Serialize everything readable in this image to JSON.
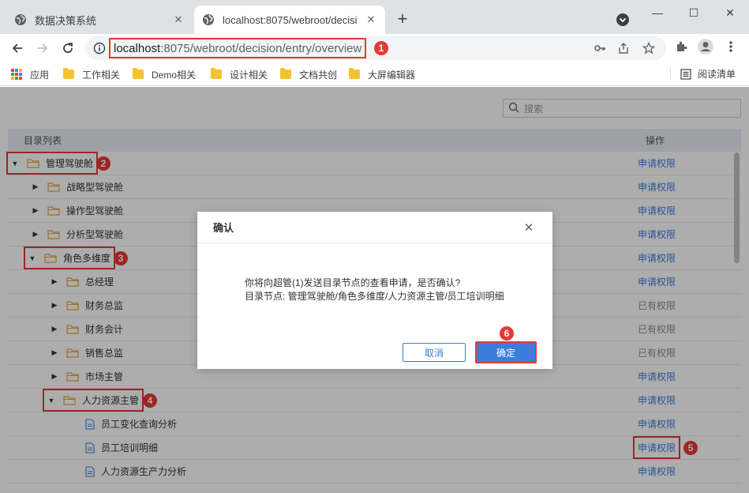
{
  "browser": {
    "tabs": [
      {
        "title": "数据决策系统",
        "active": false
      },
      {
        "title": "localhost:8075/webroot/decisi",
        "active": true
      }
    ],
    "url_host": "localhost",
    "url_rest": ":8075/webroot/decision/entry/overview",
    "bookmarks": [
      "应用",
      "工作相关",
      "Demo相关",
      "设计相关",
      "文档共创",
      "大屏编辑器"
    ],
    "reading_list": "阅读清单",
    "folder_color": "#f4c430"
  },
  "page": {
    "search_placeholder": "搜索",
    "table_header": {
      "name": "目录列表",
      "op": "操作"
    },
    "rows": [
      {
        "label": "管理驾驶舱",
        "op": "申请权限"
      },
      {
        "label": "战略型驾驶舱",
        "op": "申请权限"
      },
      {
        "label": "操作型驾驶舱",
        "op": "申请权限"
      },
      {
        "label": "分析型驾驶舱",
        "op": "申请权限"
      },
      {
        "label": "角色多维度",
        "op": "申请权限"
      },
      {
        "label": "总经理",
        "op": "申请权限"
      },
      {
        "label": "财务总监",
        "op": "已有权限"
      },
      {
        "label": "财务会计",
        "op": "已有权限"
      },
      {
        "label": "销售总监",
        "op": "已有权限"
      },
      {
        "label": "市场主管",
        "op": "申请权限"
      },
      {
        "label": "人力资源主管",
        "op": "申请权限"
      },
      {
        "label": "员工变化查询分析",
        "op": "申请权限"
      },
      {
        "label": "员工培训明细",
        "op": "申请权限"
      },
      {
        "label": "人力资源生产力分析",
        "op": "申请权限"
      }
    ]
  },
  "dialog": {
    "title": "确认",
    "line1": "你将向超管(1)发送目录节点的查看申请，是否确认?",
    "line2": "目录节点: 管理驾驶舱/角色多维度/人力资源主管/员工培训明细",
    "cancel": "取消",
    "ok": "确定"
  },
  "callouts": [
    "1",
    "2",
    "3",
    "4",
    "5",
    "6"
  ],
  "colors": {
    "accent": "#3b7ddd",
    "highlight": "#e53935"
  }
}
